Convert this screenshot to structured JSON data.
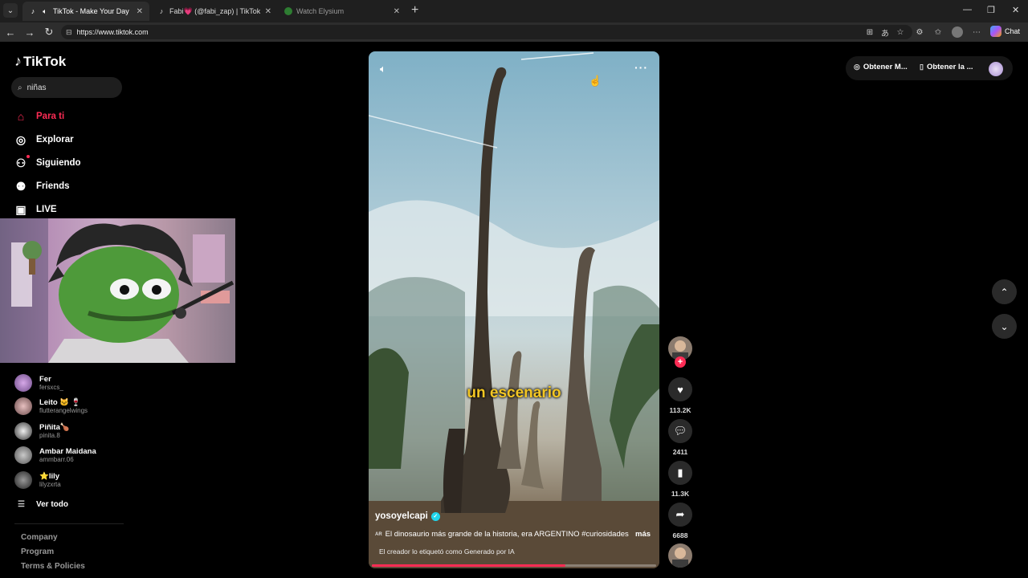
{
  "browser": {
    "tabs": [
      {
        "title": "TikTok - Make Your Day",
        "active": true,
        "icon": "tiktok-icon"
      },
      {
        "title": "Fabi💗 (@fabi_zap) | TikTok",
        "active": false,
        "icon": "tiktok-icon"
      },
      {
        "title": "Watch Elysium",
        "active": false,
        "icon": "globe-icon"
      }
    ],
    "url": "https://www.tiktok.com",
    "chat_label": "Chat"
  },
  "tiktok": {
    "logo_text": "TikTok",
    "search_value": "niñas",
    "nav": [
      {
        "label": "Para ti",
        "icon": "home-icon",
        "active": true
      },
      {
        "label": "Explorar",
        "icon": "compass-icon",
        "active": false
      },
      {
        "label": "Siguiendo",
        "icon": "following-icon",
        "active": false
      },
      {
        "label": "Friends",
        "icon": "friends-icon",
        "active": false
      },
      {
        "label": "LIVE",
        "icon": "live-icon",
        "active": false
      }
    ],
    "following_accounts": [
      {
        "name": "Fer",
        "handle": "fersxcs_"
      },
      {
        "name": "Leito 🐱 🍷",
        "handle": "flutterangelwings"
      },
      {
        "name": "Piñita🍗",
        "handle": "pinita.8"
      },
      {
        "name": "Ambar Maidana",
        "handle": "ammbarr.06"
      },
      {
        "name": "⭐lily",
        "handle": "lilyzxrta"
      }
    ],
    "see_all": "Ver todo",
    "footer": [
      "Company",
      "Program",
      "Terms & Policies"
    ]
  },
  "video": {
    "overlay_caption": "un escenario",
    "author": "yosoyelcapi",
    "ar_badge": "AR",
    "description": "El dinosaurio más grande de la historia, era ARGENTINO #curiosidades",
    "more": "más",
    "ai_label": "El creador lo etiquetó como Generado por IA",
    "progress_percent": 68,
    "likes": "113.2K",
    "comments": "2411",
    "saves": "11.3K",
    "shares": "6688"
  },
  "top_right": {
    "get_coins": "Obtener M...",
    "get_app": "Obtener la ..."
  },
  "colors": {
    "brand_red": "#fe2c55",
    "caption_yellow": "#f3c623",
    "verified_cyan": "#20d5ec"
  }
}
